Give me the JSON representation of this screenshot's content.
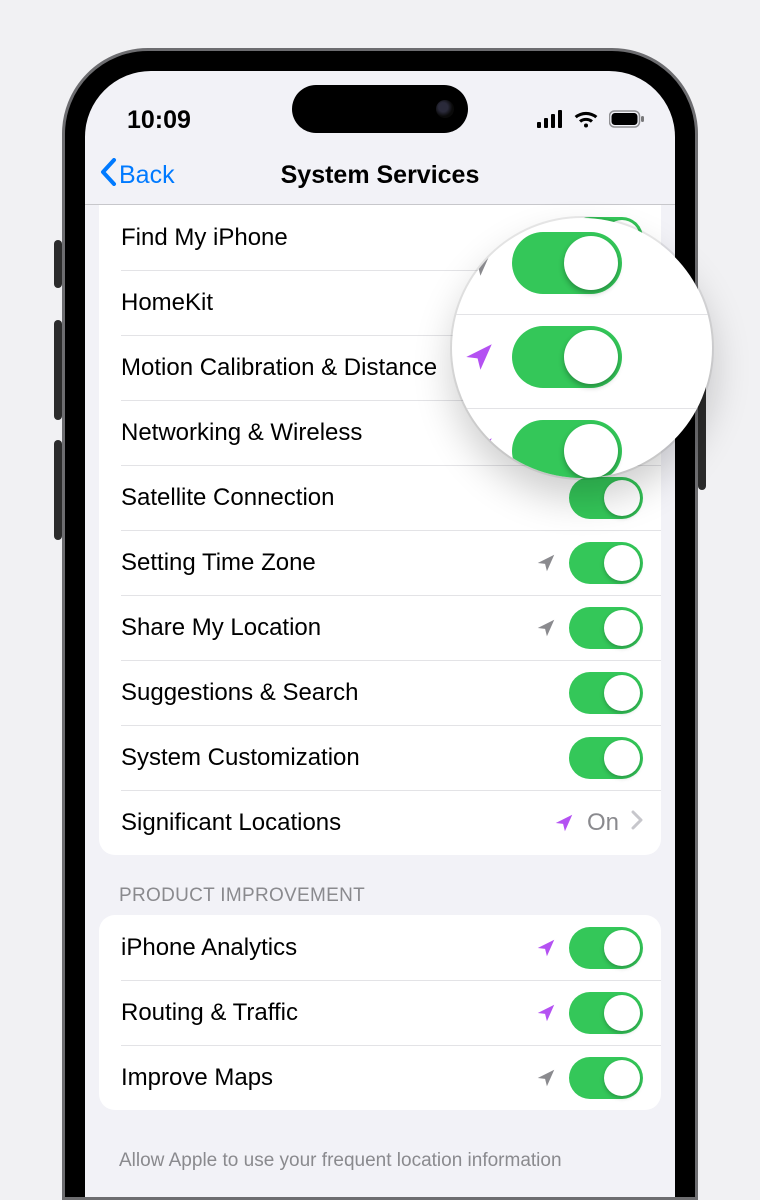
{
  "status": {
    "time": "10:09"
  },
  "nav": {
    "back": "Back",
    "title": "System Services"
  },
  "colors": {
    "accent": "#007aff",
    "toggle_on": "#34c759",
    "arrow_purple": "#b451f2",
    "arrow_gray": "#8a8a8e"
  },
  "sections": [
    {
      "id": "main",
      "rows": [
        {
          "label": "Find My iPhone",
          "arrow": "gray",
          "type": "toggle",
          "on": true
        },
        {
          "label": "HomeKit",
          "arrow": null,
          "type": "toggle",
          "on": true
        },
        {
          "label": "Motion Calibration & Distance",
          "arrow": "purple",
          "type": "toggle",
          "on": true
        },
        {
          "label": "Networking & Wireless",
          "arrow": "purple",
          "type": "toggle",
          "on": true
        },
        {
          "label": "Satellite Connection",
          "arrow": null,
          "type": "toggle",
          "on": true
        },
        {
          "label": "Setting Time Zone",
          "arrow": "gray",
          "type": "toggle",
          "on": true
        },
        {
          "label": "Share My Location",
          "arrow": "gray",
          "type": "toggle",
          "on": true
        },
        {
          "label": "Suggestions & Search",
          "arrow": null,
          "type": "toggle",
          "on": true
        },
        {
          "label": "System Customization",
          "arrow": null,
          "type": "toggle",
          "on": true
        },
        {
          "label": "Significant Locations",
          "arrow": "purple",
          "type": "link",
          "value": "On"
        }
      ]
    },
    {
      "id": "product-improvement",
      "header": "PRODUCT IMPROVEMENT",
      "rows": [
        {
          "label": "iPhone Analytics",
          "arrow": "purple",
          "type": "toggle",
          "on": true
        },
        {
          "label": "Routing & Traffic",
          "arrow": "purple",
          "type": "toggle",
          "on": true
        },
        {
          "label": "Improve Maps",
          "arrow": "gray",
          "type": "toggle",
          "on": true
        }
      ],
      "footer": "Allow Apple to use your frequent location information"
    }
  ]
}
